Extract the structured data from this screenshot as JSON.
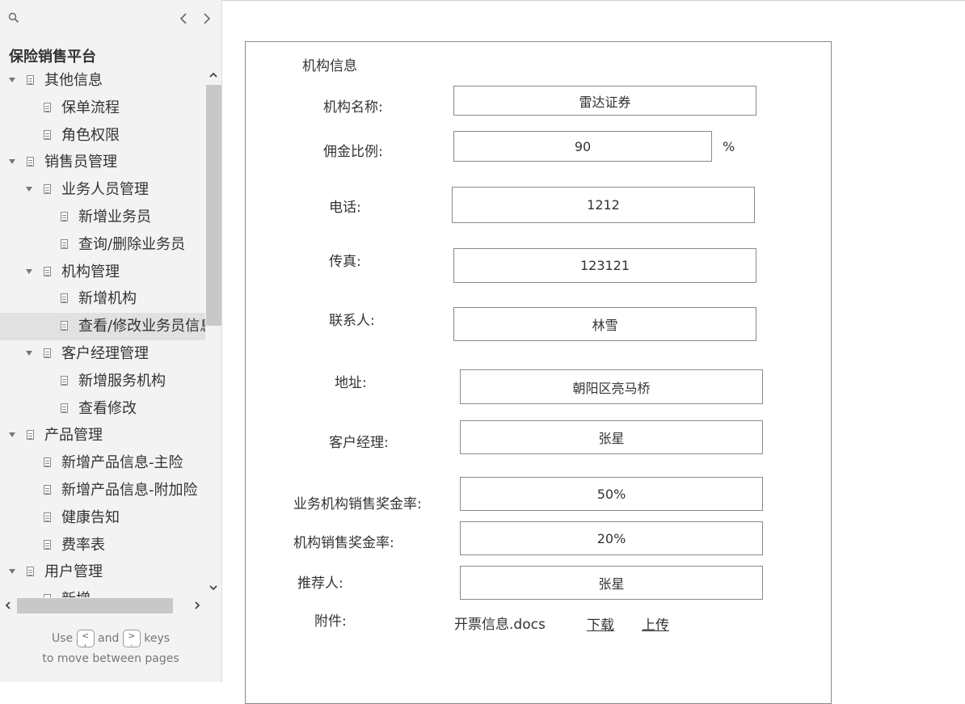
{
  "sidebar": {
    "project_title": "保险销售平台",
    "tree": [
      {
        "label": "其他信息",
        "level": 0,
        "expanded": true
      },
      {
        "label": "保单流程",
        "level": 1
      },
      {
        "label": "角色权限",
        "level": 1
      },
      {
        "label": "销售员管理",
        "level": 0,
        "expanded": true
      },
      {
        "label": "业务人员管理",
        "level": 1,
        "expanded": true
      },
      {
        "label": "新增业务员",
        "level": 2
      },
      {
        "label": "查询/删除业务员",
        "level": 2
      },
      {
        "label": "机构管理",
        "level": 1,
        "expanded": true
      },
      {
        "label": "新增机构",
        "level": 2
      },
      {
        "label": "查看/修改业务员信息",
        "level": 2,
        "selected": true
      },
      {
        "label": "客户经理管理",
        "level": 1,
        "expanded": true
      },
      {
        "label": "新增服务机构",
        "level": 2
      },
      {
        "label": "查看修改",
        "level": 2
      },
      {
        "label": "产品管理",
        "level": 0,
        "expanded": true
      },
      {
        "label": "新增产品信息-主险",
        "level": 1
      },
      {
        "label": "新增产品信息-附加险",
        "level": 1
      },
      {
        "label": "健康告知",
        "level": 1
      },
      {
        "label": "费率表",
        "level": 1
      },
      {
        "label": "用户管理",
        "level": 0,
        "expanded": true
      },
      {
        "label": "新增",
        "level": 1
      }
    ],
    "hint": {
      "use": "Use",
      "and": "and",
      "keys": "keys",
      "line2": "to move between pages",
      "key_prev": "<",
      "key_next": ">",
      "key_prev_sub": ",",
      "key_next_sub": "."
    }
  },
  "form": {
    "section_title": "机构信息",
    "fields": {
      "org_name": {
        "label": "机构名称:",
        "value": "雷达证券"
      },
      "commission": {
        "label": "佣金比例:",
        "value": "90",
        "unit": "%"
      },
      "phone": {
        "label": "电话:",
        "value": "1212"
      },
      "fax": {
        "label": "传真:",
        "value": "123121"
      },
      "contact": {
        "label": "联系人:",
        "value": "林雪"
      },
      "address": {
        "label": "地址:",
        "value": "朝阳区亮马桥"
      },
      "account_manager": {
        "label": "客户经理:",
        "value": "张星"
      },
      "branch_bonus_rate": {
        "label": "业务机构销售奖金率:",
        "value": "50%"
      },
      "org_bonus_rate": {
        "label": "机构销售奖金率:",
        "value": "20%"
      },
      "referrer": {
        "label": "推荐人:",
        "value": "张星"
      }
    },
    "attachment": {
      "label": "附件:",
      "file_name": "开票信息.docs",
      "download": "下载",
      "upload": "上传"
    }
  }
}
